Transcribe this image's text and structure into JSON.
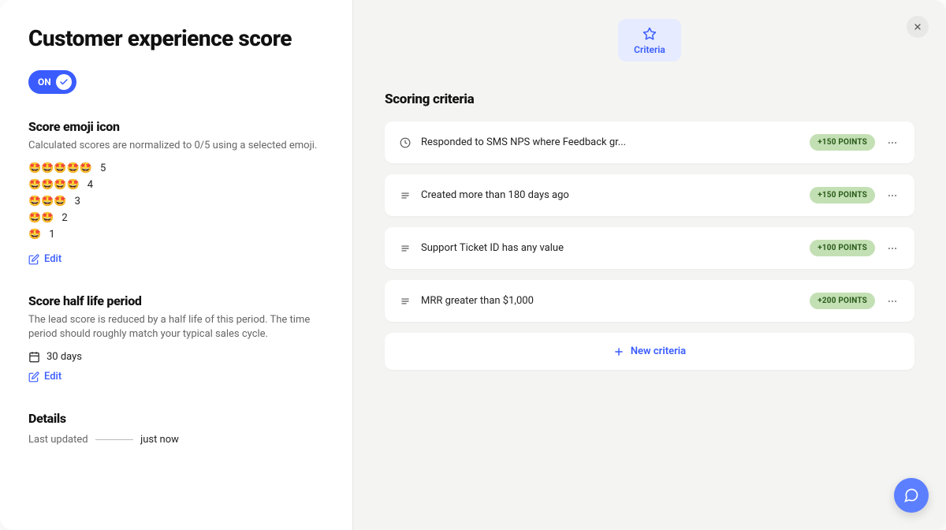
{
  "page": {
    "title": "Customer experience score"
  },
  "toggle": {
    "label": "ON"
  },
  "emoji_section": {
    "title": "Score emoji icon",
    "desc": "Calculated scores are normalized to 0/5 using a selected emoji.",
    "emoji": "🤩",
    "rows": [
      {
        "count": 5
      },
      {
        "count": 4
      },
      {
        "count": 3
      },
      {
        "count": 2
      },
      {
        "count": 1
      }
    ],
    "edit_label": "Edit"
  },
  "halflife_section": {
    "title": "Score half life period",
    "desc": "The lead score is reduced by a half life of this period. The time period should roughly match your typical sales cycle.",
    "value": "30 days",
    "edit_label": "Edit"
  },
  "details_section": {
    "title": "Details",
    "label": "Last updated",
    "value": "just now"
  },
  "tab": {
    "label": "Criteria"
  },
  "criteria": {
    "heading": "Scoring criteria",
    "items": [
      {
        "icon": "clock",
        "text": "Responded to SMS NPS where Feedback gr...",
        "points": "+150 POINTS"
      },
      {
        "icon": "text",
        "text": "Created more than 180 days ago",
        "points": "+150 POINTS"
      },
      {
        "icon": "text",
        "text": "Support Ticket ID has any value",
        "points": "+100 POINTS"
      },
      {
        "icon": "text",
        "text": "MRR greater than $1,000",
        "points": "+200 POINTS"
      }
    ],
    "new_label": "New criteria"
  }
}
